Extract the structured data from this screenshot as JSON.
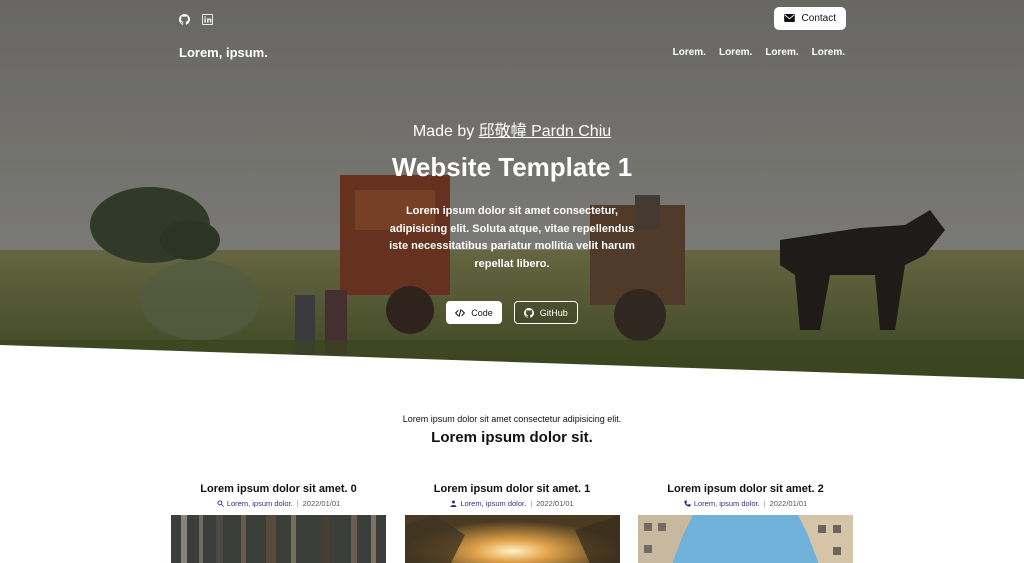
{
  "topbar": {
    "social_icons": [
      "github-icon",
      "linkedin-icon"
    ],
    "contact_label": "Contact",
    "contact_icon": "envelope-icon"
  },
  "navbar": {
    "brand": "Lorem, ipsum.",
    "links": [
      "Lorem.",
      "Lorem.",
      "Lorem.",
      "Lorem."
    ]
  },
  "hero": {
    "madeby_prefix": "Made by ",
    "madeby_author": "邱敬幃 Pardn Chiu",
    "title": "Website Template 1",
    "description": "Lorem ipsum dolor sit amet consectetur, adipisicing elit. Soluta atque, vitae repellendus iste necessitatibus pariatur mollitia velit harum repellat libero.",
    "buttons": [
      {
        "label": "Code",
        "icon": "code-icon"
      },
      {
        "label": "GitHub",
        "icon": "github-icon"
      }
    ]
  },
  "section": {
    "subtitle": "Lorem ipsum dolor sit amet consectetur adipisicing elit.",
    "title": "Lorem ipsum dolor sit."
  },
  "cards": [
    {
      "title": "Lorem ipsum dolor sit amet. 0",
      "author": "Lorem, ipsum dolor.",
      "date": "2022/01/01",
      "icon": "search-icon"
    },
    {
      "title": "Lorem ipsum dolor sit amet. 1",
      "author": "Lorem, ipsum dolor.",
      "date": "2022/01/01",
      "icon": "user-icon"
    },
    {
      "title": "Lorem ipsum dolor sit amet. 2",
      "author": "Lorem, ipsum dolor.",
      "date": "2022/01/01",
      "icon": "phone-icon"
    }
  ],
  "colors": {
    "accent_link": "#3a2d8a",
    "overlay": "#191919"
  }
}
